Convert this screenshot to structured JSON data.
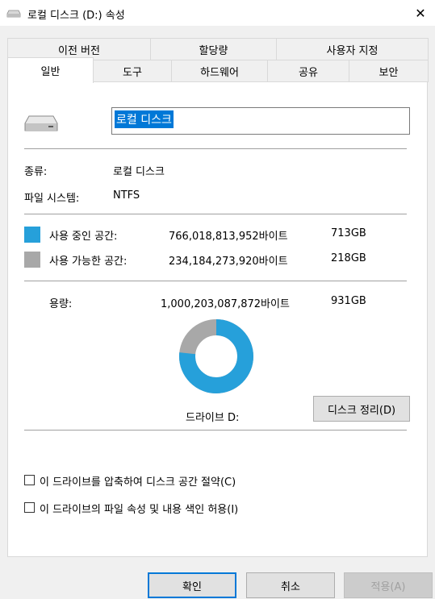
{
  "window": {
    "title": "로컬 디스크 (D:) 속성",
    "close_symbol": "✕"
  },
  "tabs_row1": [
    "이전 버전",
    "할당량",
    "사용자 지정"
  ],
  "tabs_row2": [
    "일반",
    "도구",
    "하드웨어",
    "공유",
    "보안"
  ],
  "active_tab": "일반",
  "general": {
    "name_value": "로컬 디스크",
    "type_label": "종류:",
    "type_value": "로컬 디스크",
    "fs_label": "파일 시스템:",
    "fs_value": "NTFS",
    "used_label": "사용 중인 공간:",
    "used_bytes": "766,018,813,952바이트",
    "used_gb": "713GB",
    "free_label": "사용 가능한 공간:",
    "free_bytes": "234,184,273,920바이트",
    "free_gb": "218GB",
    "capacity_label": "용량:",
    "capacity_bytes": "1,000,203,087,872바이트",
    "capacity_gb": "931GB",
    "drive_label": "드라이브 D:",
    "cleanup_button": "디스크 정리(D)",
    "compress_label": "이 드라이브를 압축하여 디스크 공간 절약(C)",
    "index_label": "이 드라이브의 파일 속성 및 내용 색인 허용(I)",
    "compress_checked": false,
    "index_checked": false
  },
  "colors": {
    "used": "#26a0da",
    "free": "#a8a8a8",
    "accent": "#0078d7"
  },
  "usage": {
    "used_fraction": 0.766,
    "free_fraction": 0.234
  },
  "buttons": {
    "ok": "확인",
    "cancel": "취소",
    "apply": "적용(A)"
  }
}
